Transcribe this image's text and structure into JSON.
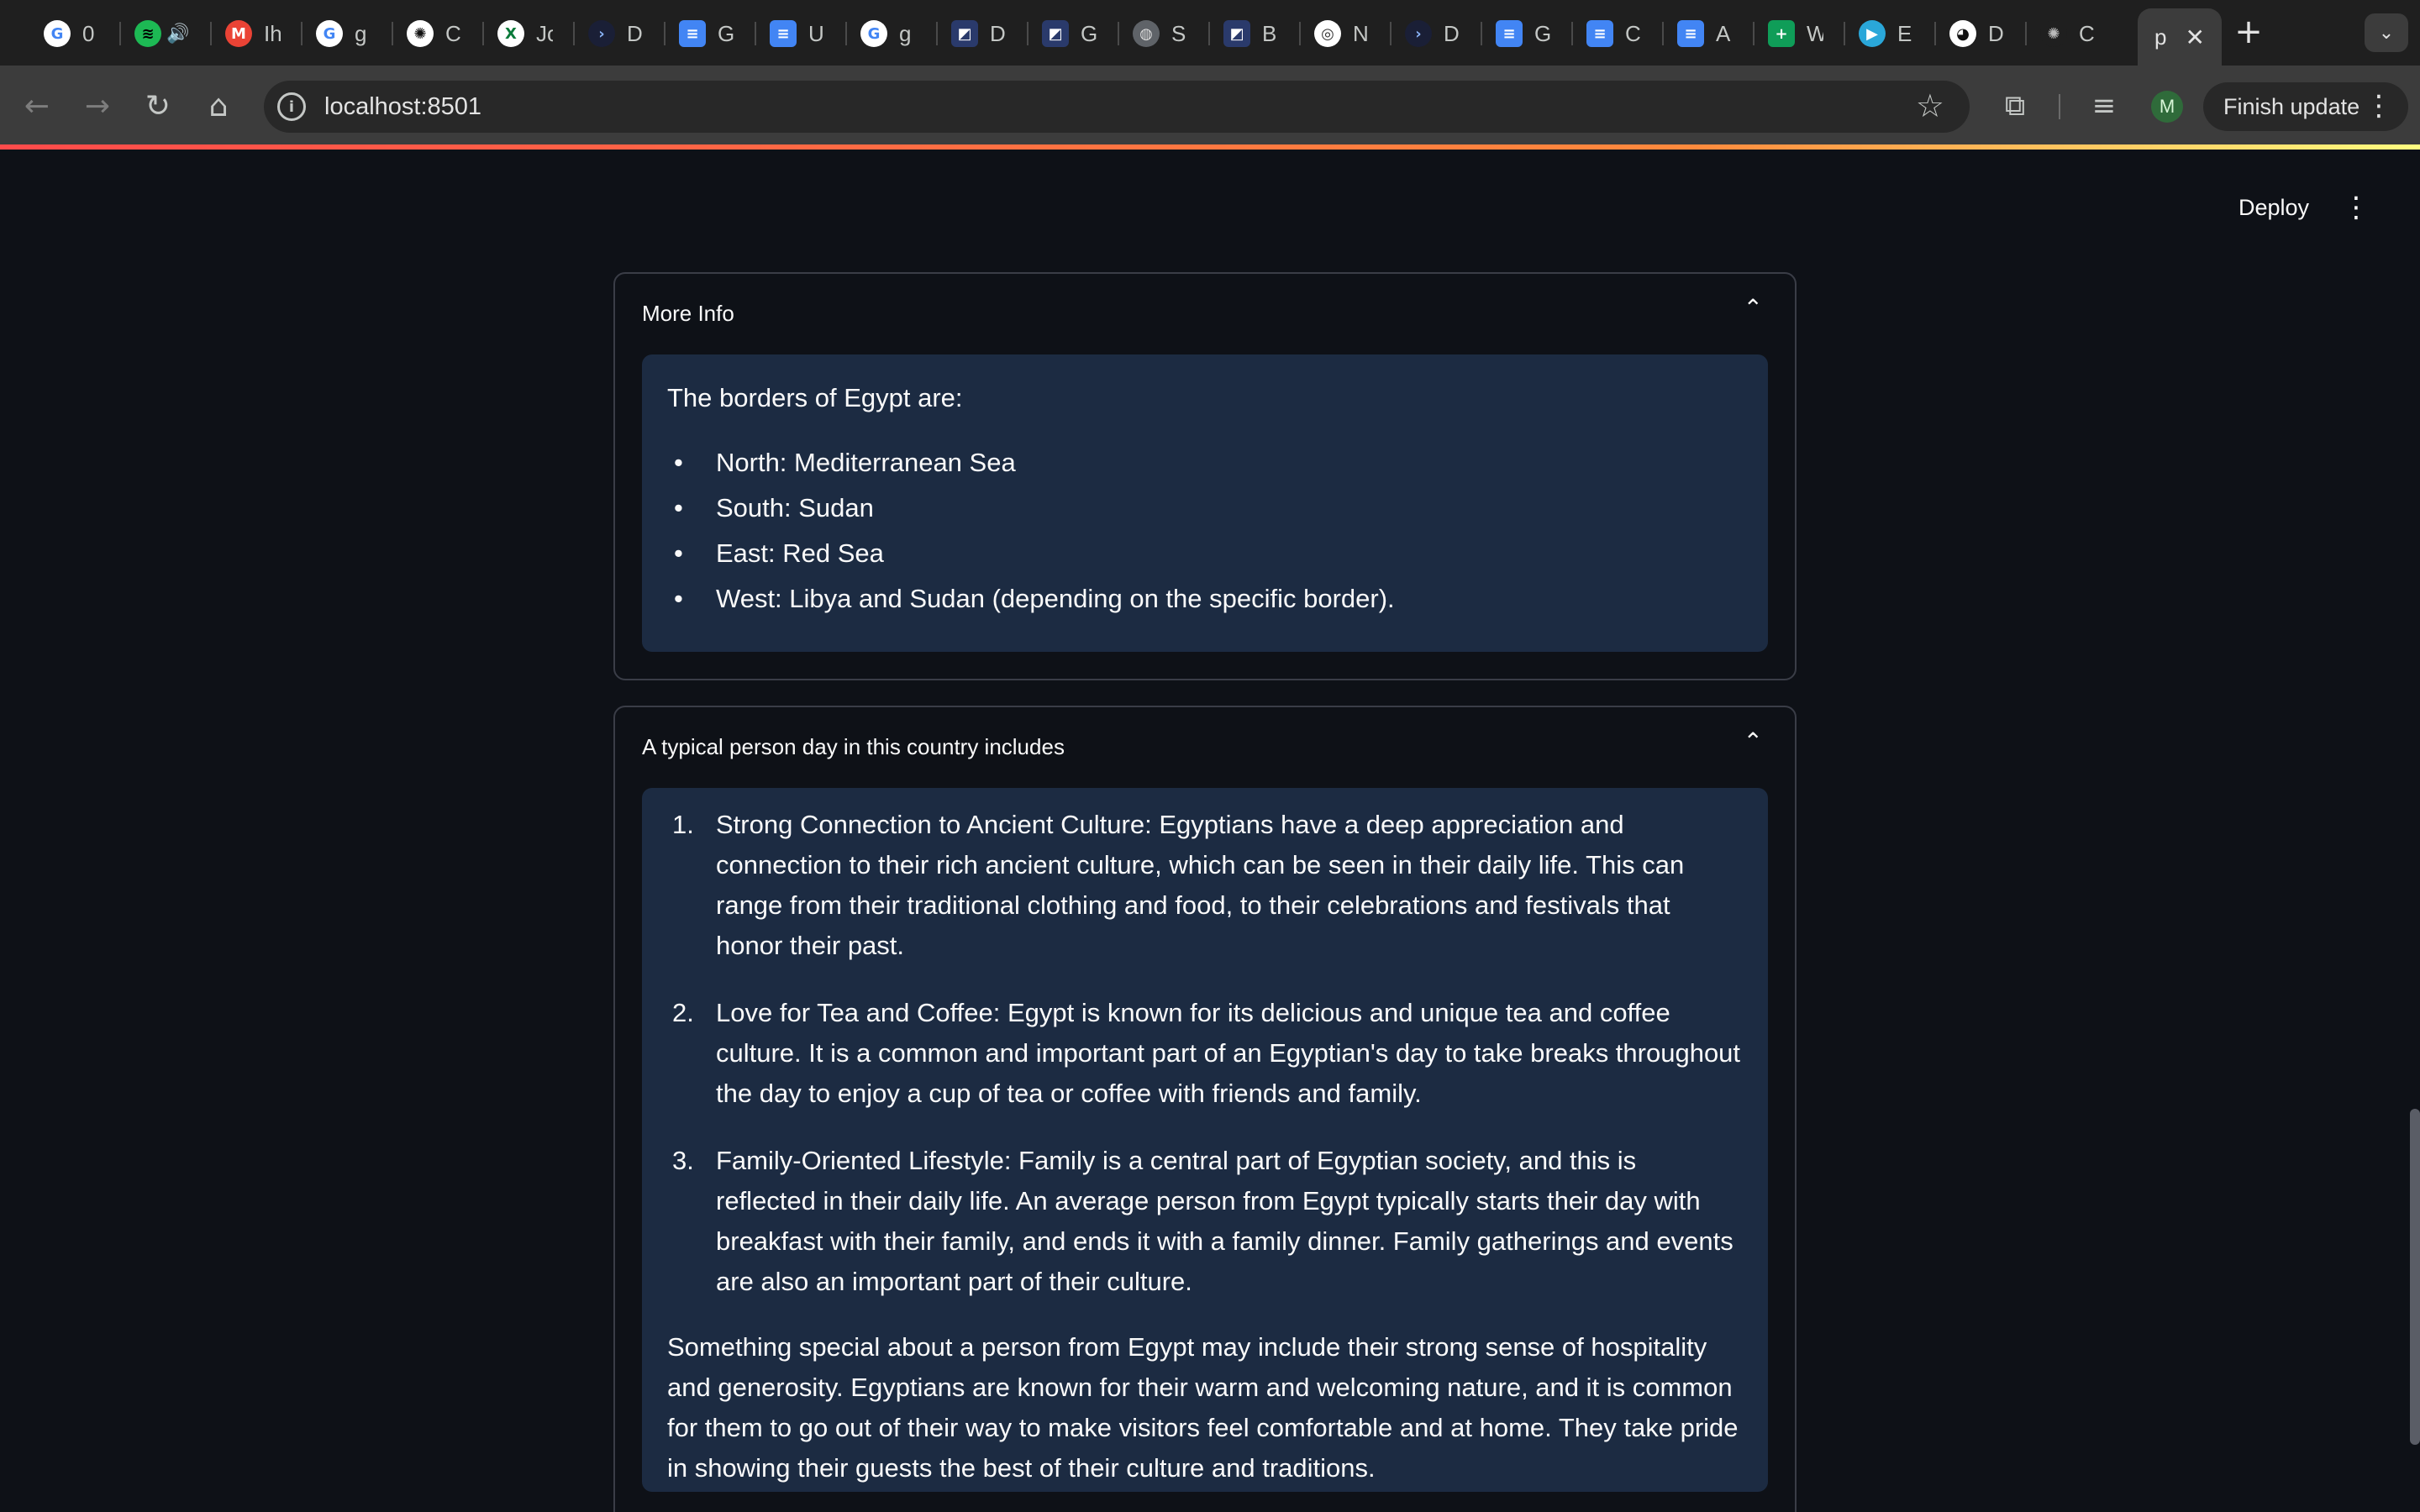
{
  "browser": {
    "tabs": [
      {
        "icon": "google-icon",
        "label": "0",
        "color": "#ffffff",
        "glyph": "G",
        "text_color": "#4285f4"
      },
      {
        "icon": "spotify-icon",
        "label": "",
        "color": "#1db954",
        "glyph": "≋",
        "text_color": "#000000",
        "audio": "🔊"
      },
      {
        "icon": "gmail-icon",
        "label": "Ih",
        "color": "#ea4335",
        "glyph": "M",
        "text_color": "#ffffff"
      },
      {
        "icon": "google-icon",
        "label": "g",
        "color": "#ffffff",
        "glyph": "G",
        "text_color": "#4285f4"
      },
      {
        "icon": "chatgpt-icon",
        "label": "C",
        "color": "#ffffff",
        "glyph": "✺",
        "text_color": "#111111"
      },
      {
        "icon": "xl-icon",
        "label": "Jo",
        "color": "#ffffff",
        "glyph": "X",
        "text_color": "#0a7a3a"
      },
      {
        "icon": "terminal-icon",
        "label": "D",
        "color": "#1a1f36",
        "glyph": "›",
        "text_color": "#8ab4f8"
      },
      {
        "icon": "docs-icon",
        "label": "G",
        "color": "#4285f4",
        "glyph": "≡",
        "text_color": "#ffffff"
      },
      {
        "icon": "docs-icon",
        "label": "U",
        "color": "#4285f4",
        "glyph": "≡",
        "text_color": "#ffffff"
      },
      {
        "icon": "google-icon",
        "label": "g",
        "color": "#ffffff",
        "glyph": "G",
        "text_color": "#4285f4"
      },
      {
        "icon": "app-icon",
        "label": "D",
        "color": "#2a3a6b",
        "glyph": "◩",
        "text_color": "#ffffff"
      },
      {
        "icon": "app-icon",
        "label": "G",
        "color": "#2a3a6b",
        "glyph": "◩",
        "text_color": "#ffffff"
      },
      {
        "icon": "globe-icon",
        "label": "S",
        "color": "#5f6368",
        "glyph": "◍",
        "text_color": "#dddddd"
      },
      {
        "icon": "app-icon",
        "label": "B",
        "color": "#2a3a6b",
        "glyph": "◩",
        "text_color": "#ffffff"
      },
      {
        "icon": "chrome-icon",
        "label": "N",
        "color": "#ffffff",
        "glyph": "◎",
        "text_color": "#333333"
      },
      {
        "icon": "terminal-icon",
        "label": "D",
        "color": "#1a1f36",
        "glyph": "›",
        "text_color": "#8ab4f8"
      },
      {
        "icon": "docs-icon",
        "label": "G",
        "color": "#4285f4",
        "glyph": "≡",
        "text_color": "#ffffff"
      },
      {
        "icon": "docs-icon",
        "label": "C",
        "color": "#4285f4",
        "glyph": "≡",
        "text_color": "#ffffff"
      },
      {
        "icon": "docs-icon",
        "label": "A",
        "color": "#4285f4",
        "glyph": "≡",
        "text_color": "#ffffff"
      },
      {
        "icon": "sheets-icon",
        "label": "W",
        "color": "#0f9d58",
        "glyph": "+",
        "text_color": "#ffffff"
      },
      {
        "icon": "play-icon",
        "label": "E",
        "color": "#2aa7d9",
        "glyph": "▶",
        "text_color": "#ffffff"
      },
      {
        "icon": "github-icon",
        "label": "D",
        "color": "#ffffff",
        "glyph": "◕",
        "text_color": "#111111"
      },
      {
        "icon": "chatgpt-icon",
        "label": "C",
        "color": "#1f1f1f",
        "glyph": "✺",
        "text_color": "#bbbbbb"
      }
    ],
    "active_tab": {
      "label": "p",
      "close": "✕"
    },
    "new_tab": "+",
    "tab_search": "⌄",
    "nav": {
      "back": "←",
      "forward": "→",
      "reload": "↻",
      "home": "⌂"
    },
    "url": "localhost:8501",
    "info_glyph": "i",
    "bookmark": "☆",
    "extensions_icon": "⧉",
    "media_icon": "≡",
    "profile_initial": "M",
    "finish_update": "Finish update",
    "menu_dots": "⋮"
  },
  "app": {
    "deploy": "Deploy",
    "menu": "⋮",
    "sections": [
      {
        "title": "More Info",
        "chevron": "⌃",
        "intro": "The borders of Egypt are:",
        "items": [
          "North: Mediterranean Sea",
          "South: Sudan",
          "East: Red Sea",
          "West: Libya and Sudan (depending on the specific border)."
        ]
      },
      {
        "title": "A typical person day in this country includes",
        "chevron": "⌃",
        "items": [
          {
            "num": "1.",
            "text": "Strong Connection to Ancient Culture: Egyptians have a deep appreciation and connection to their rich ancient culture, which can be seen in their daily life. This can range from their traditional clothing and food, to their celebrations and festivals that honor their past."
          },
          {
            "num": "2.",
            "text": "Love for Tea and Coffee: Egypt is known for its delicious and unique tea and coffee culture. It is a common and important part of an Egyptian's day to take breaks throughout the day to enjoy a cup of tea or coffee with friends and family."
          },
          {
            "num": "3.",
            "text": "Family-Oriented Lifestyle: Family is a central part of Egyptian society, and this is reflected in their daily life. An average person from Egypt typically starts their day with breakfast with their family, and ends it with a family dinner. Family gatherings and events are also an important part of their culture."
          }
        ],
        "closing": "Something special about a person from Egypt may include their strong sense of hospitality and generosity. Egyptians are known for their warm and welcoming nature, and it is common for them to go out of their way to make visitors feel comfortable and at home. They take pride in showing their guests the best of their culture and traditions."
      }
    ]
  }
}
